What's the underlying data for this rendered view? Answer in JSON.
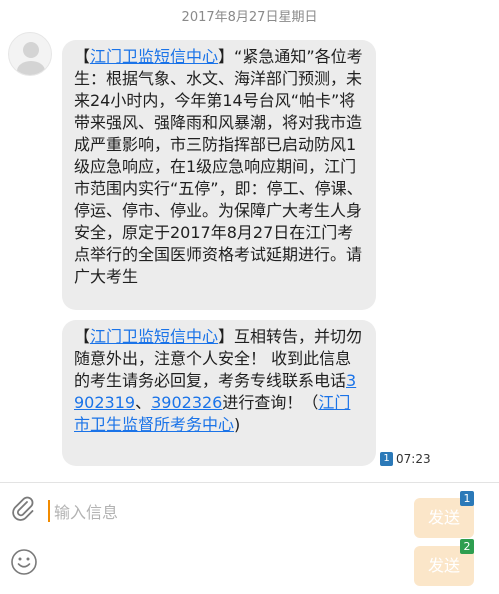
{
  "date_header": "2017年8月27日星期日",
  "messages": [
    {
      "open_bracket": "【",
      "sender_link": "江门卫监短信中心",
      "body": "】“紧急通知”各位考生：根据气象、水文、海洋部门预测，未来24小时内，今年第14号台风“帕卡”将带来强风、强降雨和风暴潮，将对我市造成严重影响，市三防指挥部已启动防风1级应急响应，在1级应急响应期间，江门市范围内实行“五停”，即：停工、停课、停运、停市、停业。为保障广大考生人身安全，原定于2017年8月27日在江门考点举行的全国医师资格考试延期进行。请广大考生"
    },
    {
      "open_bracket": "【",
      "sender_link": "江门卫监短信中心",
      "body_part1": "】互相转告，并切勿随意外出，注意个人安全！ 收到此信息的考生请务必回复，考务专线联系电话",
      "phone1": "3902319",
      "sep": "、",
      "phone2": "3902326",
      "body_part2": "进行查询！（",
      "org_link": "江门市卫生监督所考务中心",
      "close": ")"
    }
  ],
  "message_meta": {
    "sim_slot": "1",
    "time": "07:23"
  },
  "composer": {
    "placeholder": "输入信息",
    "send_label_1": "发送",
    "send_label_2": "发送",
    "sim_badge_1": "1",
    "sim_badge_2": "2"
  },
  "colors": {
    "bubble": "#ececec",
    "link": "#1a73e8",
    "sim1": "#2b79b8",
    "sim2": "#2e9e50",
    "send_button": "#fbe6c9",
    "caret": "#f28b00"
  },
  "icons": {
    "avatar": "contact-avatar-icon",
    "attach": "paperclip-icon",
    "emoji": "smiley-icon",
    "sim": "sim-card-icon"
  }
}
